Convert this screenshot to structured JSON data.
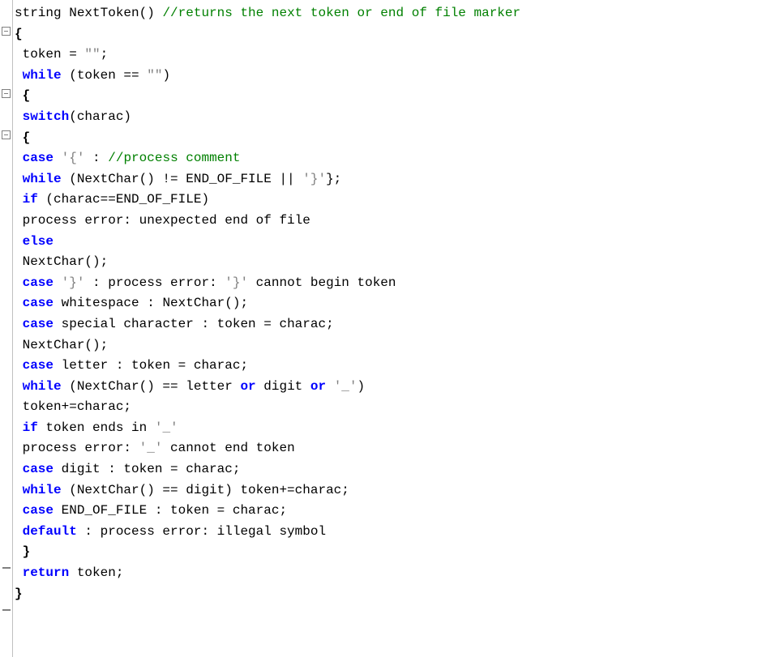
{
  "code": {
    "l1a": "string NextToken() ",
    "l1b": "//returns the next token or end of file marker",
    "l2": "{",
    "l3a": " token = ",
    "l3b": "\"\"",
    "l3c": ";",
    "l4a": " while",
    "l4b": " (token == ",
    "l4c": "\"\"",
    "l4d": ")",
    "l5": " {",
    "l6a": " switch",
    "l6b": "(charac)",
    "l7": " {",
    "l8a": " case",
    "l8b": " ",
    "l8c": "'{'",
    "l8d": " : ",
    "l8e": "//process comment",
    "l9a": " while",
    "l9b": " (NextChar() != END_OF_FILE || ",
    "l9c": "'}'",
    "l9d": "};",
    "l10a": " if",
    "l10b": " (charac==END_OF_FILE)",
    "l11": " process error: unexpected end of file",
    "l12": " else",
    "l13": " NextChar();",
    "l14a": " case",
    "l14b": " ",
    "l14c": "'}'",
    "l14d": " : process error: ",
    "l14e": "'}'",
    "l14f": " cannot begin token",
    "l15a": " case",
    "l15b": " whitespace : NextChar();",
    "l16a": " case",
    "l16b": " special character : token = charac;",
    "l17": " NextChar();",
    "l18a": " case",
    "l18b": " letter : token = charac;",
    "l19a": " while",
    "l19b": " (NextChar() == letter ",
    "l19c": "or",
    "l19d": " digit ",
    "l19e": "or",
    "l19f": " ",
    "l19g": "'_'",
    "l19h": ")",
    "l20": " token+=charac;",
    "l21a": " if",
    "l21b": " token ends in ",
    "l21c": "'_'",
    "l22a": " process error: ",
    "l22b": "'_'",
    "l22c": " cannot end token",
    "l23a": " case",
    "l23b": " digit : token = charac;",
    "l24a": " while",
    "l24b": " (NextChar() == digit) token+=charac;",
    "l25a": " case",
    "l25b": " END_OF_FILE : token = charac;",
    "l26a": " default",
    "l26b": " : process error: illegal symbol",
    "l27": " }",
    "l28a": " return",
    "l28b": " token;",
    "l29": "}"
  }
}
